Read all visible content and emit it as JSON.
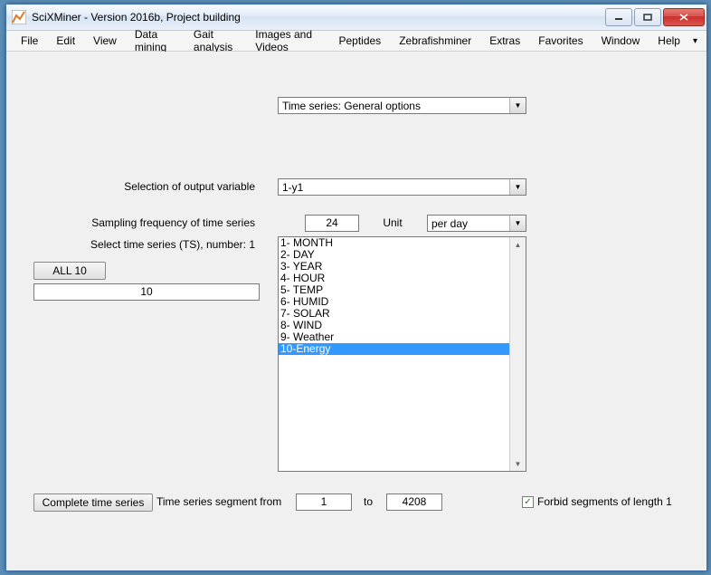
{
  "window": {
    "title": "SciXMiner - Version 2016b, Project building"
  },
  "menu": {
    "items": [
      "File",
      "Edit",
      "View",
      "Data mining",
      "Gait analysis",
      "Images and Videos",
      "Peptides",
      "Zebrafishminer",
      "Extras",
      "Favorites",
      "Window",
      "Help"
    ]
  },
  "top_dropdown": {
    "value": "Time series: General options"
  },
  "output_var": {
    "label": "Selection of output variable",
    "value": "1-y1"
  },
  "sampling": {
    "label": "Sampling frequency of time series",
    "value": "24",
    "unit_label": "Unit",
    "unit_value": "per day"
  },
  "select_ts": {
    "label": "Select time series (TS), number: 1"
  },
  "all_btn": {
    "label": "ALL 10"
  },
  "count_box": {
    "value": "10"
  },
  "listbox": {
    "items": [
      {
        "text": "1- MONTH",
        "selected": false
      },
      {
        "text": "2- DAY",
        "selected": false
      },
      {
        "text": "3- YEAR",
        "selected": false
      },
      {
        "text": "4- HOUR",
        "selected": false
      },
      {
        "text": "5- TEMP",
        "selected": false
      },
      {
        "text": "6- HUMID",
        "selected": false
      },
      {
        "text": "7- SOLAR",
        "selected": false
      },
      {
        "text": "8- WIND",
        "selected": false
      },
      {
        "text": "9- Weather",
        "selected": false
      },
      {
        "text": "10-Energy",
        "selected": true
      }
    ]
  },
  "segment": {
    "btn": "Complete time series",
    "label": "Time series segment from",
    "from": "1",
    "to_label": "to",
    "to": "4208",
    "forbid_label": "Forbid segments of length 1",
    "forbid_checked": true
  }
}
